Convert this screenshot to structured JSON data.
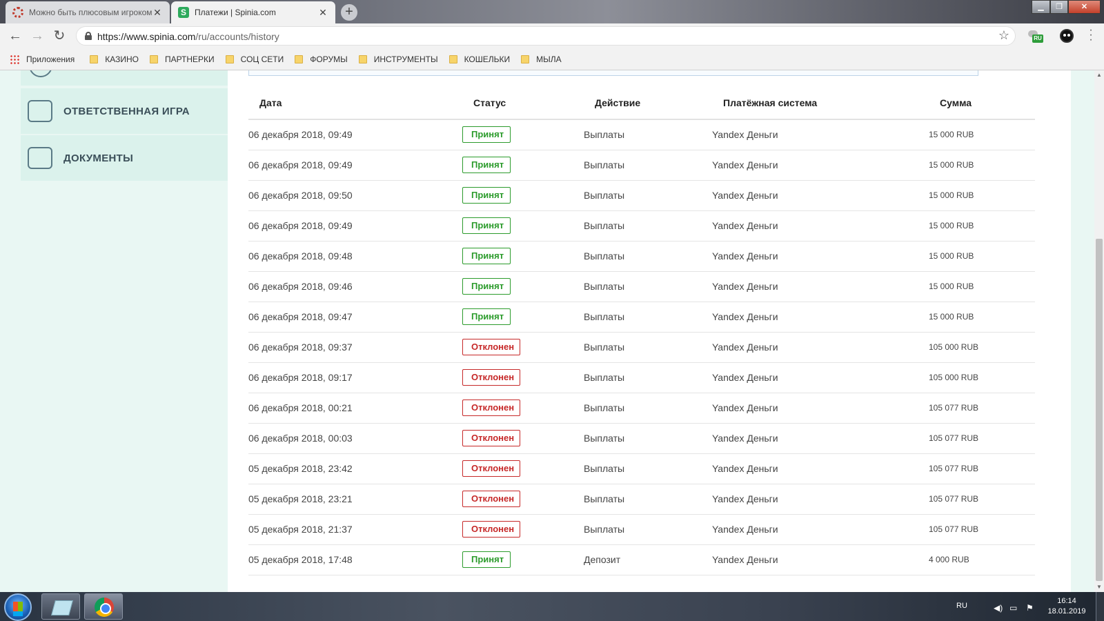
{
  "browser": {
    "tabs": [
      {
        "title": "Можно быть плюсовым игроком",
        "active": false,
        "favicon": "gear-favicon"
      },
      {
        "title": "Платежи | Spinia.com",
        "active": true,
        "favicon": "spinia-s-favicon"
      }
    ],
    "new_tab_label": "+",
    "url_host": "https://www.spinia.com",
    "url_path": "/ru/accounts/history",
    "ext_ru_label": "RU",
    "window_controls": {
      "minimize": "▁",
      "maximize": "❐",
      "close": "✕"
    }
  },
  "bookmarks": {
    "apps_label": "Приложения",
    "folders": [
      "КАЗИНО",
      "ПАРТНЕРКИ",
      "СОЦ СЕТИ",
      "ФОРУМЫ",
      "ИНСТРУМЕНТЫ",
      "КОШЕЛЬКИ",
      "МЫЛА"
    ]
  },
  "sidebar": {
    "items": [
      {
        "label": "ОТВЕТСТВЕННАЯ ИГРА",
        "icon": "wallet-icon"
      },
      {
        "label": "ДОКУМЕНТЫ",
        "icon": "id-card-icon"
      }
    ]
  },
  "history": {
    "columns": [
      "Дата",
      "Статус",
      "Действие",
      "Платёжная система",
      "Сумма"
    ],
    "rows": [
      {
        "date": "06 декабря 2018, 09:49",
        "status": "Принят",
        "ok": true,
        "action": "Выплаты",
        "system": "Yandex Деньги",
        "amount": "15 000 RUB"
      },
      {
        "date": "06 декабря 2018, 09:49",
        "status": "Принят",
        "ok": true,
        "action": "Выплаты",
        "system": "Yandex Деньги",
        "amount": "15 000 RUB"
      },
      {
        "date": "06 декабря 2018, 09:50",
        "status": "Принят",
        "ok": true,
        "action": "Выплаты",
        "system": "Yandex Деньги",
        "amount": "15 000 RUB"
      },
      {
        "date": "06 декабря 2018, 09:49",
        "status": "Принят",
        "ok": true,
        "action": "Выплаты",
        "system": "Yandex Деньги",
        "amount": "15 000 RUB"
      },
      {
        "date": "06 декабря 2018, 09:48",
        "status": "Принят",
        "ok": true,
        "action": "Выплаты",
        "system": "Yandex Деньги",
        "amount": "15 000 RUB"
      },
      {
        "date": "06 декабря 2018, 09:46",
        "status": "Принят",
        "ok": true,
        "action": "Выплаты",
        "system": "Yandex Деньги",
        "amount": "15 000 RUB"
      },
      {
        "date": "06 декабря 2018, 09:47",
        "status": "Принят",
        "ok": true,
        "action": "Выплаты",
        "system": "Yandex Деньги",
        "amount": "15 000 RUB"
      },
      {
        "date": "06 декабря 2018, 09:37",
        "status": "Отклонен",
        "ok": false,
        "action": "Выплаты",
        "system": "Yandex Деньги",
        "amount": "105 000 RUB"
      },
      {
        "date": "06 декабря 2018, 09:17",
        "status": "Отклонен",
        "ok": false,
        "action": "Выплаты",
        "system": "Yandex Деньги",
        "amount": "105 000 RUB"
      },
      {
        "date": "06 декабря 2018, 00:21",
        "status": "Отклонен",
        "ok": false,
        "action": "Выплаты",
        "system": "Yandex Деньги",
        "amount": "105 077 RUB"
      },
      {
        "date": "06 декабря 2018, 00:03",
        "status": "Отклонен",
        "ok": false,
        "action": "Выплаты",
        "system": "Yandex Деньги",
        "amount": "105 077 RUB"
      },
      {
        "date": "05 декабря 2018, 23:42",
        "status": "Отклонен",
        "ok": false,
        "action": "Выплаты",
        "system": "Yandex Деньги",
        "amount": "105 077 RUB"
      },
      {
        "date": "05 декабря 2018, 23:21",
        "status": "Отклонен",
        "ok": false,
        "action": "Выплаты",
        "system": "Yandex Деньги",
        "amount": "105 077 RUB"
      },
      {
        "date": "05 декабря 2018, 21:37",
        "status": "Отклонен",
        "ok": false,
        "action": "Выплаты",
        "system": "Yandex Деньги",
        "amount": "105 077 RUB"
      },
      {
        "date": "05 декабря 2018, 17:48",
        "status": "Принят",
        "ok": true,
        "action": "Депозит",
        "system": "Yandex Деньги",
        "amount": "4 000 RUB"
      }
    ]
  },
  "colors": {
    "accepted": "#2b9b2b",
    "rejected": "#c62828",
    "sidebar_bg": "#dbf2ec",
    "page_bg": "#e9f7f3"
  },
  "taskbar": {
    "lang": "RU",
    "time": "16:14",
    "date": "18.01.2019",
    "tray_icons": [
      "speaker-icon",
      "network-icon",
      "flag-icon"
    ]
  }
}
